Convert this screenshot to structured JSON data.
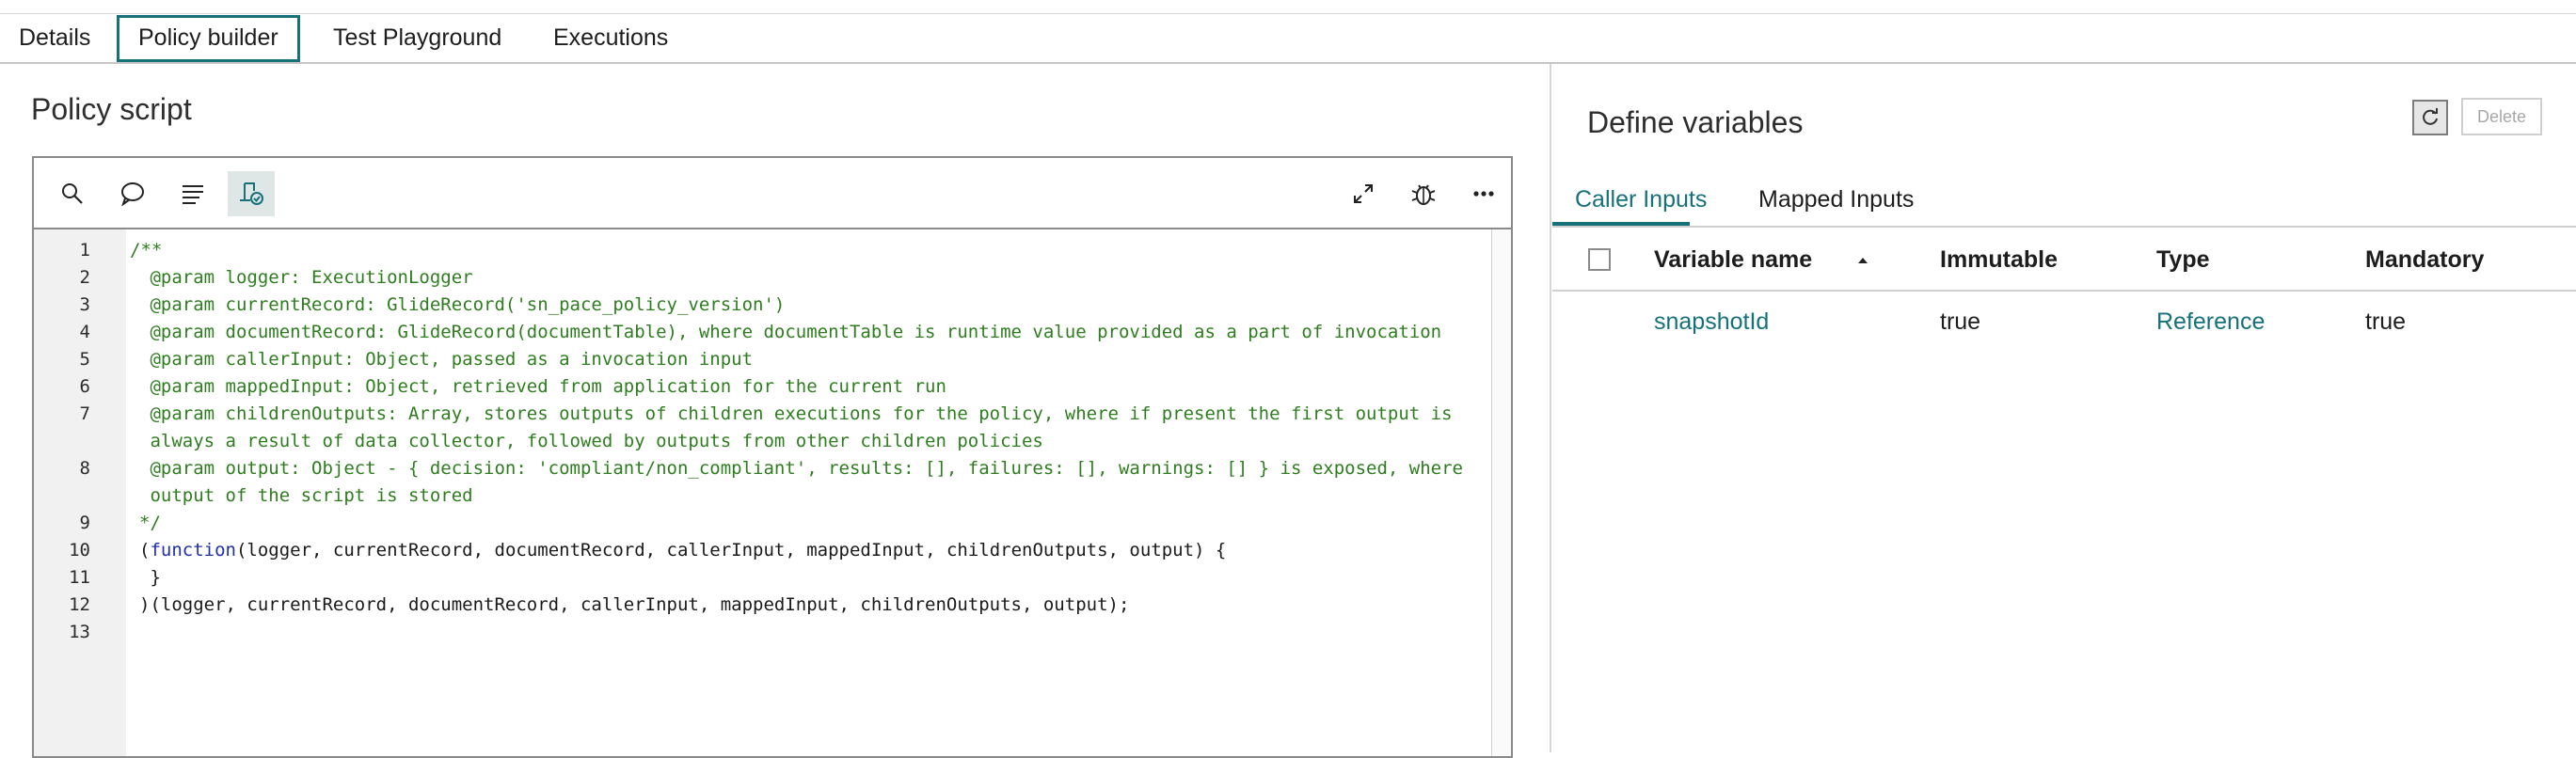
{
  "tabs": [
    {
      "label": "Details"
    },
    {
      "label": "Policy builder"
    },
    {
      "label": "Test Playground"
    },
    {
      "label": "Executions"
    }
  ],
  "left": {
    "title": "Policy script",
    "toolbar": [
      "search-icon",
      "comment-icon",
      "format-icon",
      "script-settings-icon",
      "expand-icon",
      "debug-icon",
      "more-icon"
    ]
  },
  "code": {
    "line_numbers": [
      "1",
      "2",
      "3",
      "4",
      "5",
      "6",
      "7",
      "8",
      "9",
      "10",
      "11",
      "12",
      "13"
    ],
    "lines": [
      "/**",
      " @param logger: ExecutionLogger",
      " @param currentRecord: GlideRecord('sn_pace_policy_version')",
      " @param documentRecord: GlideRecord(documentTable), where documentTable is runtime value provided as a part of invocation",
      " @param callerInput: Object, passed as a invocation input",
      " @param mappedInput: Object, retrieved from application for the current run",
      " @param childrenOutputs: Array, stores outputs of children executions for the policy, where if present the first output is",
      " always a result of data collector, followed by outputs from other children policies",
      " @param output: Object - { decision: 'compliant/non_compliant', results: [], failures: [], warnings: [] } is exposed, where",
      " output of the script is stored",
      "*/",
      "(",
      "function",
      "(logger, currentRecord, documentRecord, callerInput, mappedInput, childrenOutputs, output) {",
      " }",
      ")(logger, currentRecord, documentRecord, callerInput, mappedInput, childrenOutputs, output);"
    ]
  },
  "right": {
    "title": "Define variables",
    "delete_label": "Delete",
    "subtabs": [
      {
        "label": "Caller Inputs"
      },
      {
        "label": "Mapped Inputs"
      }
    ],
    "columns": [
      "Variable name",
      "Immutable",
      "Type",
      "Mandatory"
    ],
    "rows": [
      {
        "name": "snapshotId",
        "immutable": "true",
        "type": "Reference",
        "mandatory": "true"
      }
    ]
  },
  "colors": {
    "accent": "#16717a",
    "comment": "#2e7d1f",
    "keyword": "#1f2fa8"
  }
}
